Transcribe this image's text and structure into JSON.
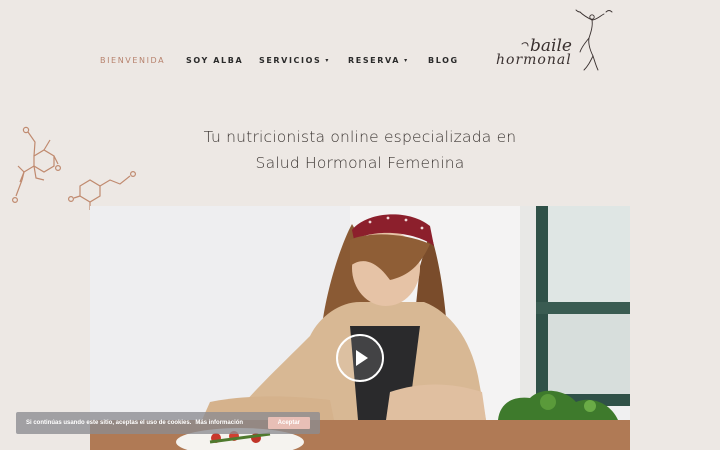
{
  "nav": {
    "items": [
      {
        "label": "BIENVENIDA",
        "active": true,
        "dropdown": false
      },
      {
        "label": "SOY ALBA",
        "active": false,
        "dropdown": false
      },
      {
        "label": "SERVICIOS",
        "active": false,
        "dropdown": true
      },
      {
        "label": "RESERVA",
        "active": false,
        "dropdown": true
      },
      {
        "label": "BLOG",
        "active": false,
        "dropdown": false
      }
    ],
    "caret": "▾"
  },
  "logo": {
    "line1": "baile",
    "line2": "hormonal"
  },
  "headline": {
    "line1": "Tu nutricionista online especializada en",
    "line2": "Salud Hormonal Femenina"
  },
  "video": {
    "play_icon": "play-icon"
  },
  "cookie": {
    "text": "Si continúas usando este sitio, aceptas el uso de cookies.",
    "more_label": "Más información",
    "accept_label": "Aceptar"
  },
  "colors": {
    "background": "#ede8e4",
    "accent": "#b7826d",
    "molecule": "#c08a6f",
    "accept_button": "#e8bfb6"
  }
}
